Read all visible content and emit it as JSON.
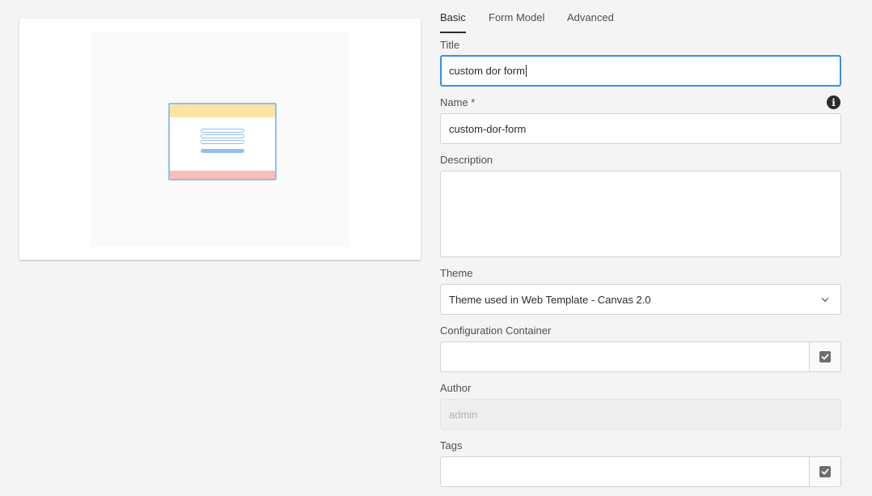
{
  "tabs": [
    {
      "label": "Basic",
      "active": true
    },
    {
      "label": "Form Model",
      "active": false
    },
    {
      "label": "Advanced",
      "active": false
    }
  ],
  "fields": {
    "title": {
      "label": "Title",
      "value": "custom dor form"
    },
    "name": {
      "label": "Name *",
      "value": "custom-dor-form",
      "icon": "info-icon"
    },
    "description": {
      "label": "Description",
      "value": ""
    },
    "theme": {
      "label": "Theme",
      "value": "Theme used in Web Template - Canvas 2.0",
      "icon": "chevron-down-icon"
    },
    "configuration_container": {
      "label": "Configuration Container",
      "value": "",
      "icon": "checkmark-icon"
    },
    "author": {
      "label": "Author",
      "value": "admin"
    },
    "tags": {
      "label": "Tags",
      "value": "",
      "icon": "checkmark-icon"
    }
  },
  "colors": {
    "focus_border": "#378ef0",
    "thumb_header": "#fde4a6",
    "thumb_footer": "#fbbcbc",
    "thumb_accent": "#90c1ef"
  }
}
